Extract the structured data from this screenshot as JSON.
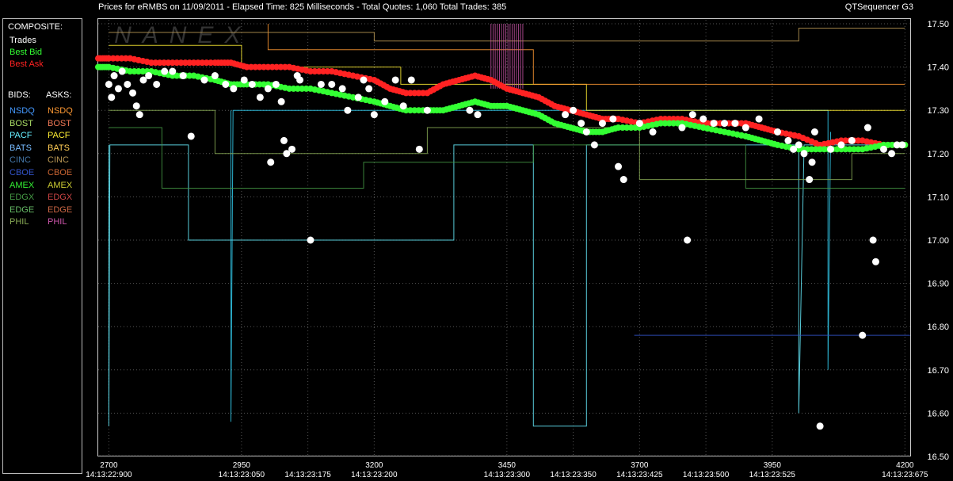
{
  "header": {
    "title": "Prices for  eRMBS  on  11/09/2011  -  Elapsed Time: 825 Milliseconds  -  Total Quotes: 1,060  Total Trades: 385",
    "right": "QTSequencer G3"
  },
  "watermark": "NANEX",
  "legend": {
    "composite_heading": "COMPOSITE:",
    "composite": [
      {
        "label": "Trades",
        "color": "#ffffff"
      },
      {
        "label": "Best Bid",
        "color": "#33ff33"
      },
      {
        "label": "Best Ask",
        "color": "#ff2222"
      }
    ],
    "bids_heading": "BIDS:",
    "asks_heading": "ASKS:",
    "exchanges": [
      {
        "bid": "NSDQ",
        "ask": "NSDQ",
        "bid_color": "#4499ff",
        "ask_color": "#ff9933"
      },
      {
        "bid": "BOST",
        "ask": "BOST",
        "bid_color": "#aadd66",
        "ask_color": "#ee7755"
      },
      {
        "bid": "PACF",
        "ask": "PACF",
        "bid_color": "#66eeff",
        "ask_color": "#ffee33"
      },
      {
        "bid": "BATS",
        "ask": "BATS",
        "bid_color": "#77bbff",
        "ask_color": "#ffcc55"
      },
      {
        "bid": "CINC",
        "ask": "CINC",
        "bid_color": "#4477aa",
        "ask_color": "#bb9955"
      },
      {
        "bid": "CBOE",
        "ask": "CBOE",
        "bid_color": "#3355cc",
        "ask_color": "#cc6633"
      },
      {
        "bid": "AMEX",
        "ask": "AMEX",
        "bid_color": "#33ee33",
        "ask_color": "#cccc33"
      },
      {
        "bid": "EDGX",
        "ask": "EDGX",
        "bid_color": "#449944",
        "ask_color": "#cc4444"
      },
      {
        "bid": "EDGE",
        "ask": "EDGE",
        "bid_color": "#66bb66",
        "ask_color": "#cc6644"
      },
      {
        "bid": "PHIL",
        "ask": "PHIL",
        "bid_color": "#88aa55",
        "ask_color": "#cc55aa"
      }
    ]
  },
  "chart_data": {
    "type": "scatter",
    "ylim": [
      16.5,
      17.5
    ],
    "xlim": [
      2680,
      4210
    ],
    "yticks": [
      "17.50",
      "17.40",
      "17.30",
      "17.20",
      "17.10",
      "17.00",
      "16.90",
      "16.80",
      "16.70",
      "16.60",
      "16.50"
    ],
    "xticks": [
      {
        "x": 2700,
        "label": "2700",
        "time": "14:13:22:900"
      },
      {
        "x": 2950,
        "label": "2950",
        "time": "14:13:23:050"
      },
      {
        "x": 3075,
        "label": "",
        "time": "14:13:23:175"
      },
      {
        "x": 3200,
        "label": "3200",
        "time": "14:13:23:200"
      },
      {
        "x": 3450,
        "label": "3450",
        "time": "14:13:23:300"
      },
      {
        "x": 3575,
        "label": "",
        "time": "14:13:23:350"
      },
      {
        "x": 3700,
        "label": "3700",
        "time": "14:13:23:425"
      },
      {
        "x": 3825,
        "label": "",
        "time": "14:13:23:500"
      },
      {
        "x": 3950,
        "label": "3950",
        "time": "14:13:23:525"
      },
      {
        "x": 4200,
        "label": "4200",
        "time": "14:13:23:675"
      }
    ],
    "series": [
      {
        "name": "Best Ask",
        "color": "#ff2222",
        "points": [
          [
            2680,
            17.42
          ],
          [
            2700,
            17.42
          ],
          [
            2740,
            17.42
          ],
          [
            2780,
            17.41
          ],
          [
            2820,
            17.41
          ],
          [
            2860,
            17.41
          ],
          [
            2900,
            17.41
          ],
          [
            2930,
            17.41
          ],
          [
            2960,
            17.4
          ],
          [
            3000,
            17.4
          ],
          [
            3040,
            17.4
          ],
          [
            3080,
            17.39
          ],
          [
            3120,
            17.39
          ],
          [
            3160,
            17.38
          ],
          [
            3200,
            17.37
          ],
          [
            3230,
            17.35
          ],
          [
            3260,
            17.34
          ],
          [
            3300,
            17.34
          ],
          [
            3330,
            17.36
          ],
          [
            3360,
            17.37
          ],
          [
            3390,
            17.38
          ],
          [
            3420,
            17.37
          ],
          [
            3450,
            17.35
          ],
          [
            3480,
            17.34
          ],
          [
            3510,
            17.33
          ],
          [
            3540,
            17.31
          ],
          [
            3570,
            17.3
          ],
          [
            3600,
            17.29
          ],
          [
            3630,
            17.28
          ],
          [
            3660,
            17.28
          ],
          [
            3700,
            17.27
          ],
          [
            3740,
            17.28
          ],
          [
            3780,
            17.28
          ],
          [
            3820,
            17.27
          ],
          [
            3860,
            17.27
          ],
          [
            3900,
            17.27
          ],
          [
            3930,
            17.26
          ],
          [
            3960,
            17.25
          ],
          [
            4000,
            17.24
          ],
          [
            4040,
            17.22
          ],
          [
            4080,
            17.23
          ],
          [
            4120,
            17.23
          ],
          [
            4160,
            17.22
          ],
          [
            4200,
            17.22
          ]
        ]
      },
      {
        "name": "Best Bid",
        "color": "#33ff33",
        "points": [
          [
            2680,
            17.4
          ],
          [
            2700,
            17.4
          ],
          [
            2740,
            17.39
          ],
          [
            2780,
            17.39
          ],
          [
            2820,
            17.38
          ],
          [
            2860,
            17.38
          ],
          [
            2900,
            17.37
          ],
          [
            2930,
            17.36
          ],
          [
            2960,
            17.36
          ],
          [
            3000,
            17.36
          ],
          [
            3040,
            17.35
          ],
          [
            3080,
            17.35
          ],
          [
            3120,
            17.34
          ],
          [
            3160,
            17.33
          ],
          [
            3200,
            17.32
          ],
          [
            3230,
            17.31
          ],
          [
            3260,
            17.3
          ],
          [
            3300,
            17.3
          ],
          [
            3330,
            17.3
          ],
          [
            3360,
            17.31
          ],
          [
            3390,
            17.32
          ],
          [
            3420,
            17.31
          ],
          [
            3450,
            17.31
          ],
          [
            3480,
            17.3
          ],
          [
            3510,
            17.29
          ],
          [
            3540,
            17.27
          ],
          [
            3570,
            17.26
          ],
          [
            3600,
            17.25
          ],
          [
            3630,
            17.25
          ],
          [
            3660,
            17.26
          ],
          [
            3700,
            17.26
          ],
          [
            3740,
            17.27
          ],
          [
            3780,
            17.27
          ],
          [
            3820,
            17.26
          ],
          [
            3860,
            17.25
          ],
          [
            3900,
            17.24
          ],
          [
            3930,
            17.23
          ],
          [
            3960,
            17.22
          ],
          [
            4000,
            17.21
          ],
          [
            4040,
            17.21
          ],
          [
            4080,
            17.21
          ],
          [
            4120,
            17.21
          ],
          [
            4160,
            17.22
          ],
          [
            4200,
            17.22
          ]
        ]
      }
    ],
    "trades": [
      [
        2700,
        17.36
      ],
      [
        2705,
        17.33
      ],
      [
        2710,
        17.38
      ],
      [
        2718,
        17.35
      ],
      [
        2725,
        17.39
      ],
      [
        2735,
        17.36
      ],
      [
        2745,
        17.34
      ],
      [
        2752,
        17.31
      ],
      [
        2758,
        17.29
      ],
      [
        2765,
        17.37
      ],
      [
        2775,
        17.38
      ],
      [
        2790,
        17.36
      ],
      [
        2805,
        17.39
      ],
      [
        2820,
        17.39
      ],
      [
        2840,
        17.38
      ],
      [
        2855,
        17.24
      ],
      [
        2880,
        17.37
      ],
      [
        2900,
        17.38
      ],
      [
        2920,
        17.36
      ],
      [
        2935,
        17.35
      ],
      [
        2955,
        17.37
      ],
      [
        2970,
        17.36
      ],
      [
        2985,
        17.33
      ],
      [
        3000,
        17.35
      ],
      [
        3005,
        17.18
      ],
      [
        3015,
        17.36
      ],
      [
        3025,
        17.32
      ],
      [
        3030,
        17.23
      ],
      [
        3035,
        17.2
      ],
      [
        3045,
        17.21
      ],
      [
        3055,
        17.38
      ],
      [
        3060,
        17.37
      ],
      [
        3080,
        17.0
      ],
      [
        3100,
        17.36
      ],
      [
        3120,
        17.36
      ],
      [
        3140,
        17.35
      ],
      [
        3150,
        17.3
      ],
      [
        3170,
        17.33
      ],
      [
        3180,
        17.37
      ],
      [
        3190,
        17.35
      ],
      [
        3200,
        17.29
      ],
      [
        3220,
        17.32
      ],
      [
        3240,
        17.37
      ],
      [
        3255,
        17.31
      ],
      [
        3270,
        17.37
      ],
      [
        3285,
        17.21
      ],
      [
        3300,
        17.3
      ],
      [
        3380,
        17.3
      ],
      [
        3395,
        17.29
      ],
      [
        3560,
        17.29
      ],
      [
        3575,
        17.3
      ],
      [
        3590,
        17.27
      ],
      [
        3600,
        17.25
      ],
      [
        3615,
        17.22
      ],
      [
        3630,
        17.27
      ],
      [
        3650,
        17.28
      ],
      [
        3660,
        17.17
      ],
      [
        3670,
        17.14
      ],
      [
        3700,
        17.27
      ],
      [
        3725,
        17.25
      ],
      [
        3780,
        17.26
      ],
      [
        3790,
        17.0
      ],
      [
        3800,
        17.29
      ],
      [
        3820,
        17.28
      ],
      [
        3840,
        17.27
      ],
      [
        3860,
        17.27
      ],
      [
        3880,
        17.27
      ],
      [
        3900,
        17.26
      ],
      [
        3925,
        17.28
      ],
      [
        3960,
        17.25
      ],
      [
        3980,
        17.23
      ],
      [
        3990,
        17.21
      ],
      [
        4000,
        17.22
      ],
      [
        4010,
        17.2
      ],
      [
        4020,
        17.14
      ],
      [
        4025,
        17.18
      ],
      [
        4030,
        17.25
      ],
      [
        4040,
        16.57
      ],
      [
        4060,
        17.21
      ],
      [
        4080,
        17.22
      ],
      [
        4100,
        17.23
      ],
      [
        4120,
        16.78
      ],
      [
        4130,
        17.26
      ],
      [
        4140,
        17.0
      ],
      [
        4145,
        16.95
      ],
      [
        4160,
        17.21
      ],
      [
        4175,
        17.2
      ],
      [
        4185,
        17.22
      ],
      [
        4195,
        17.22
      ]
    ]
  }
}
